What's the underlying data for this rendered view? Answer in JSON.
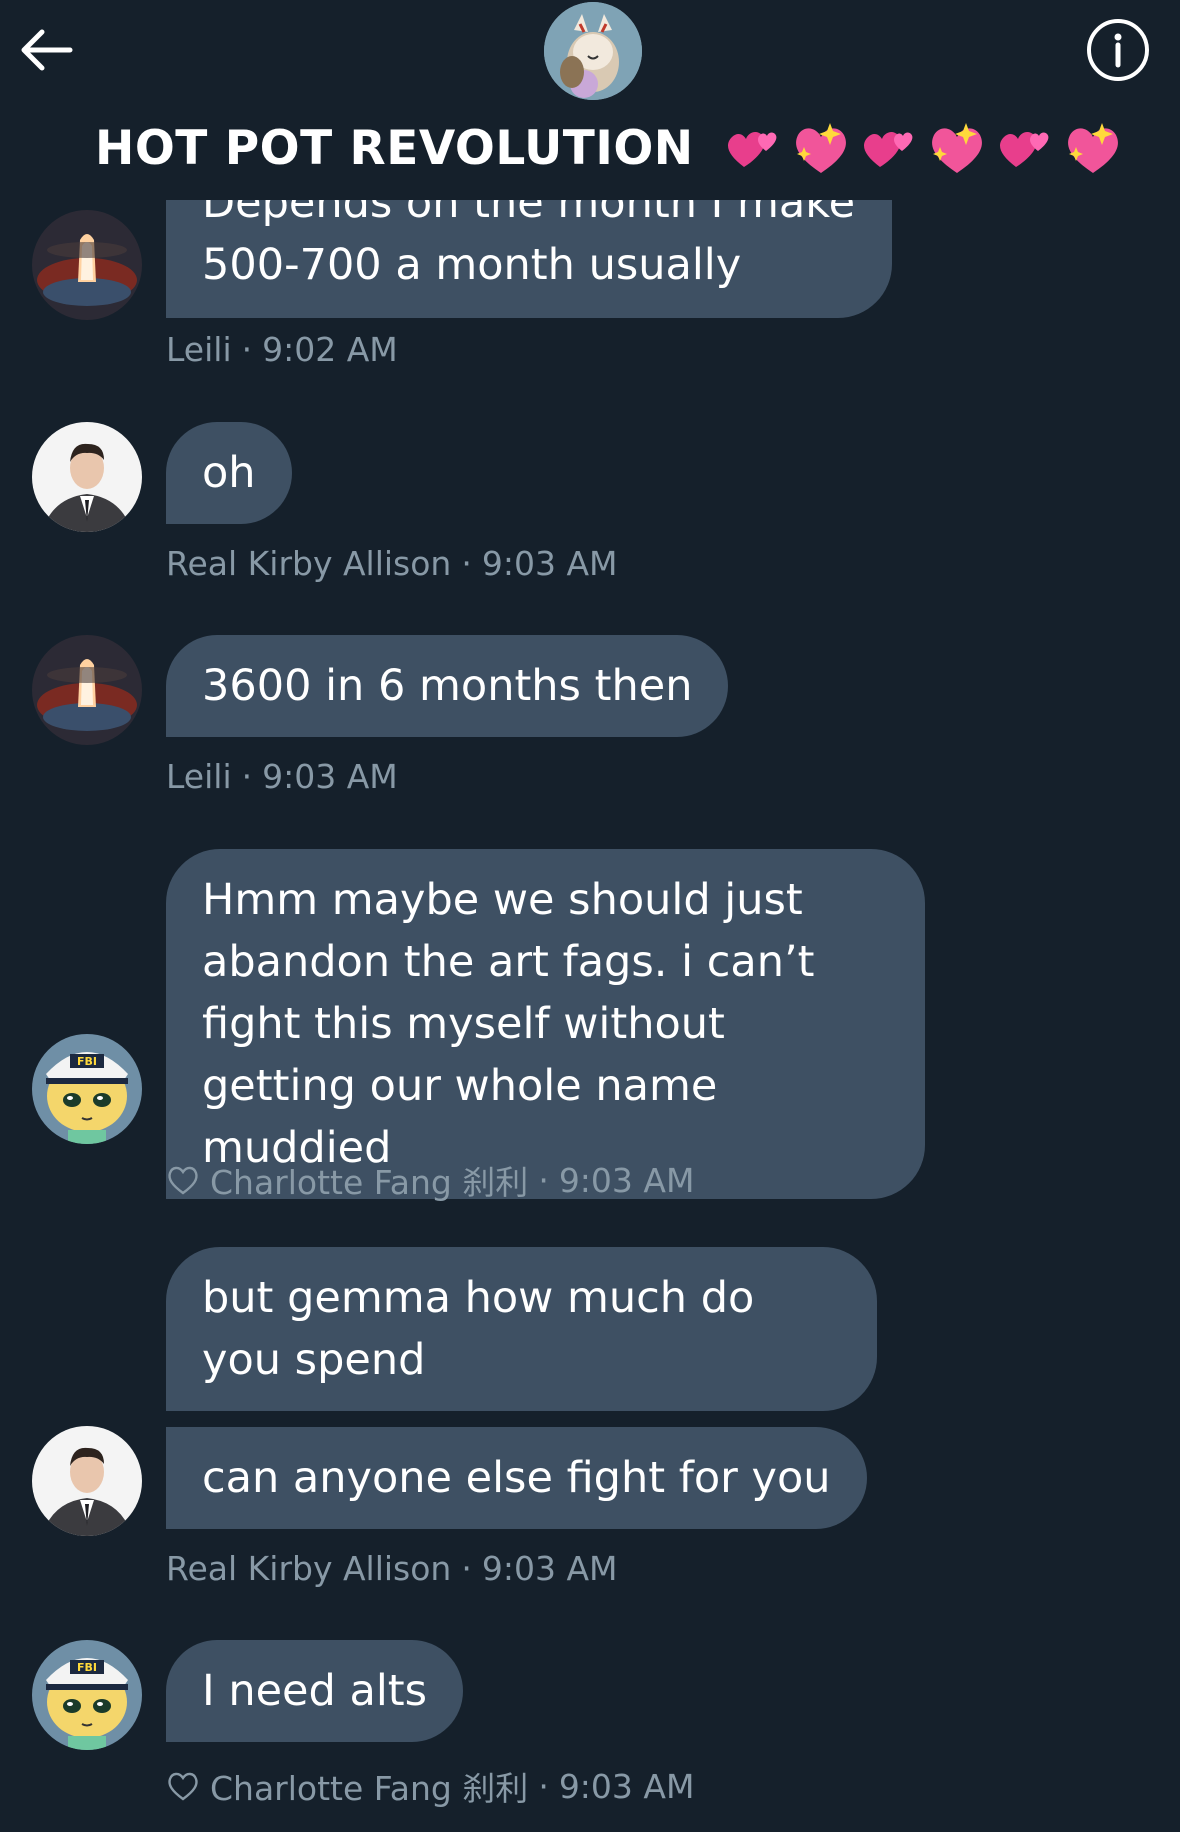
{
  "header": {
    "title": "HOT POT REVOLUTION",
    "back_icon": "arrow-left-icon",
    "info_icon": "info-icon",
    "emojis": [
      "two-hearts",
      "sparkling-heart",
      "two-hearts",
      "sparkling-heart",
      "two-hearts",
      "sparkling-heart"
    ]
  },
  "messages": [
    {
      "sender": "Leili",
      "time": "9:02 AM",
      "cut_text": "Depends on the month I make",
      "text": "500-700 a month usually",
      "liked": false
    },
    {
      "sender": "Real Kirby Allison",
      "time": "9:03 AM",
      "text": "oh",
      "liked": false
    },
    {
      "sender": "Leili",
      "time": "9:03 AM",
      "text": "3600 in 6 months then",
      "liked": false
    },
    {
      "sender": "Charlotte Fang 刹利",
      "time": "9:03 AM",
      "text": "Hmm maybe we should just abandon the art fags. i can’t fight this myself without getting our whole name muddied",
      "liked": true
    },
    {
      "sender": "Real Kirby Allison",
      "time": "9:03 AM",
      "text_1": "but gemma how much do you spend",
      "text_2": "can anyone else fight for you",
      "liked": false
    },
    {
      "sender": "Charlotte Fang 刹利",
      "time": "9:03 AM",
      "text": "I need alts",
      "liked": true
    }
  ],
  "separator": "·",
  "colors": {
    "background": "#15202b",
    "bubble": "#3e5063",
    "meta_text": "#8899a6"
  }
}
